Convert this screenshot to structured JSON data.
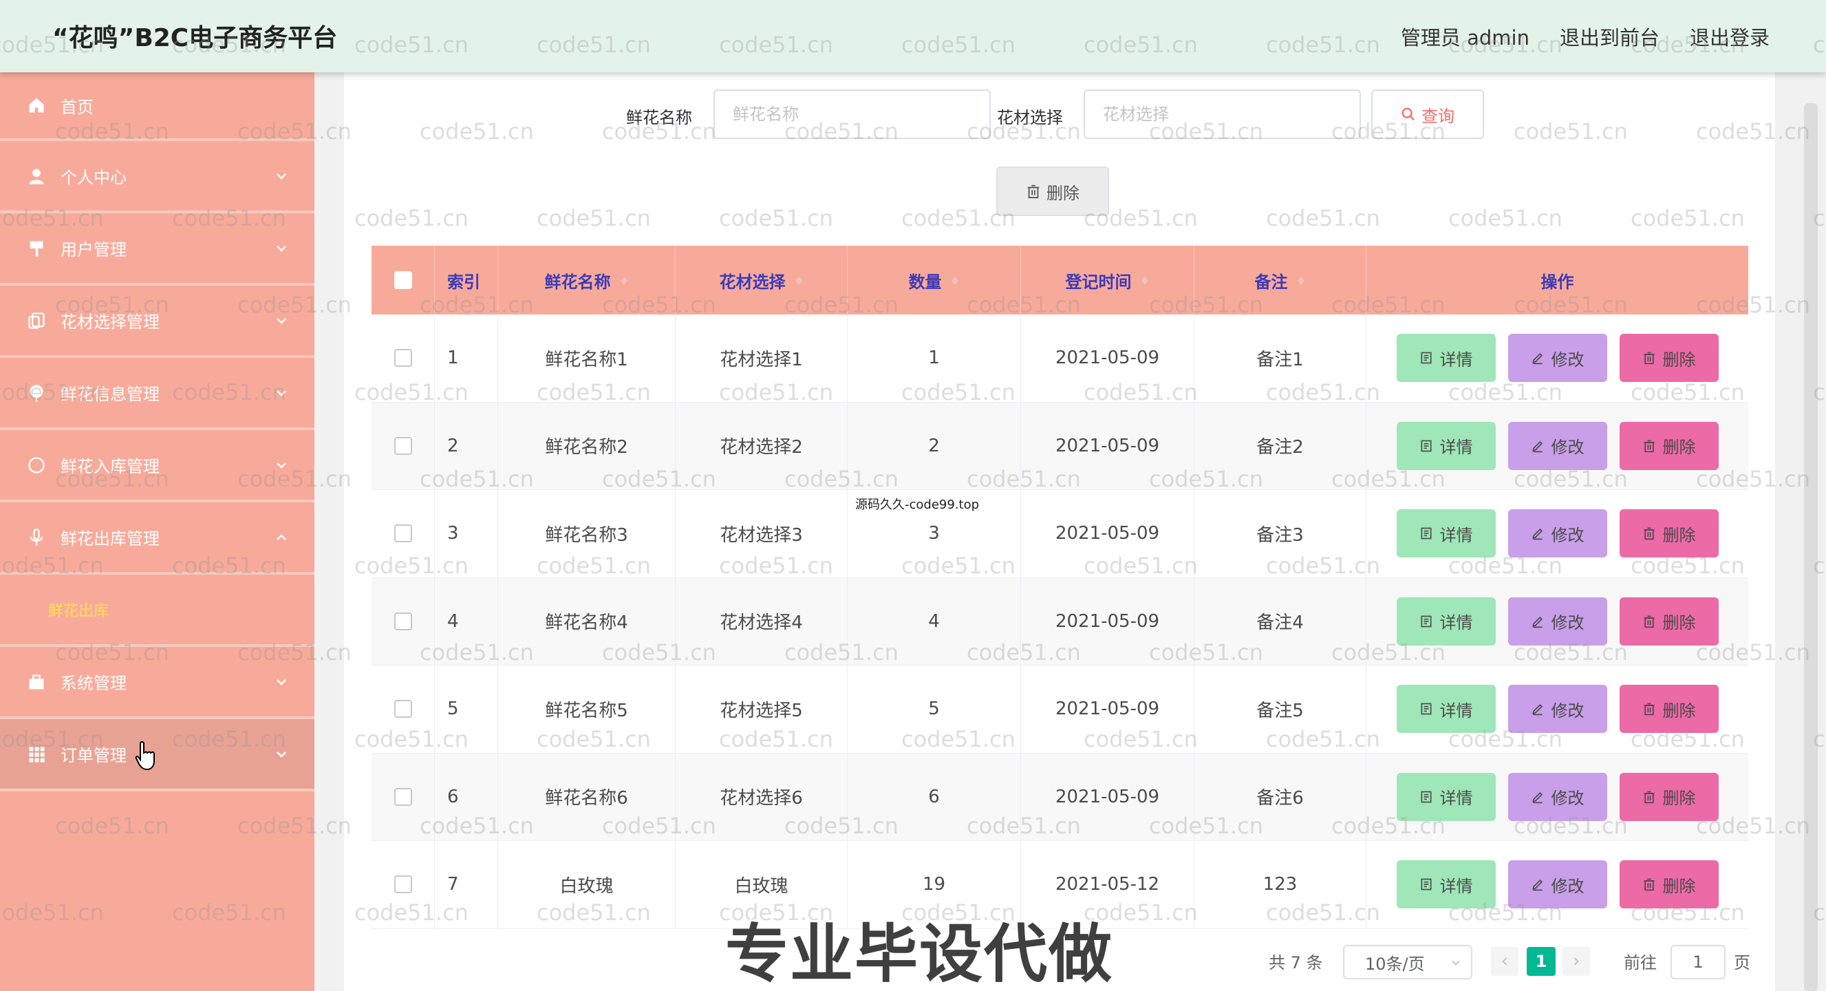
{
  "header": {
    "title": "“花鸣”B2C电子商务平台",
    "nav": [
      "管理员 admin",
      "退出到前台",
      "退出登录"
    ]
  },
  "sidebar": {
    "items": [
      {
        "label": "首页",
        "icon": "home-icon",
        "chevron": false
      },
      {
        "label": "个人中心",
        "icon": "user-icon",
        "chevron": true
      },
      {
        "label": "用户管理",
        "icon": "pin-icon",
        "chevron": true
      },
      {
        "label": "花材选择管理",
        "icon": "copy-icon",
        "chevron": true
      },
      {
        "label": "鲜花信息管理",
        "icon": "flower-icon",
        "chevron": true
      },
      {
        "label": "鲜花入库管理",
        "icon": "compass-icon",
        "chevron": true
      },
      {
        "label": "鲜花出库管理",
        "icon": "mic-icon",
        "chevron": true,
        "expanded": true
      },
      {
        "label": "系统管理",
        "icon": "briefcase-icon",
        "chevron": true
      },
      {
        "label": "订单管理",
        "icon": "grid-icon",
        "chevron": true
      }
    ],
    "submenu": "鲜花出库"
  },
  "search": {
    "name_label": "鲜花名称",
    "name_placeholder": "鲜花名称",
    "material_label": "花材选择",
    "material_placeholder": "花材选择",
    "query_button": "查询"
  },
  "toolbar": {
    "delete_label": "删除"
  },
  "table": {
    "headers": [
      "索引",
      "鲜花名称",
      "花材选择",
      "数量",
      "登记时间",
      "备注",
      "操作"
    ],
    "rows": [
      [
        "1",
        "鲜花名称1",
        "花材选择1",
        "1",
        "2021-05-09",
        "备注1"
      ],
      [
        "2",
        "鲜花名称2",
        "花材选择2",
        "2",
        "2021-05-09",
        "备注2"
      ],
      [
        "3",
        "鲜花名称3",
        "花材选择3",
        "3",
        "2021-05-09",
        "备注3"
      ],
      [
        "4",
        "鲜花名称4",
        "花材选择4",
        "4",
        "2021-05-09",
        "备注4"
      ],
      [
        "5",
        "鲜花名称5",
        "花材选择5",
        "5",
        "2021-05-09",
        "备注5"
      ],
      [
        "6",
        "鲜花名称6",
        "花材选择6",
        "6",
        "2021-05-09",
        "备注6"
      ],
      [
        "7",
        "白玫瑰",
        "白玫瑰",
        "19",
        "2021-05-12",
        "123"
      ]
    ],
    "actions": {
      "detail": "详情",
      "edit": "修改",
      "delete": "删除"
    }
  },
  "pagination": {
    "total": "共 7 条",
    "page_size": "10条/页",
    "current_page": "1",
    "goto_label": "前往",
    "goto_value": "1",
    "goto_unit": "页"
  },
  "watermark": "code51.cn",
  "overlay": {
    "small": "源码久久-code99.top",
    "big": "专业毕设代做"
  },
  "colors": {
    "header_bg": "#e4f3ea",
    "sidebar_bg": "#f8aa9a",
    "table_header_bg": "#f8aa9a",
    "header_text": "#3c3ab7",
    "detail": "#9fe6b8",
    "edit": "#c89fe8",
    "delete": "#ec6aa5",
    "active_page": "#00b894",
    "submenu_text": "#ffe14d"
  }
}
